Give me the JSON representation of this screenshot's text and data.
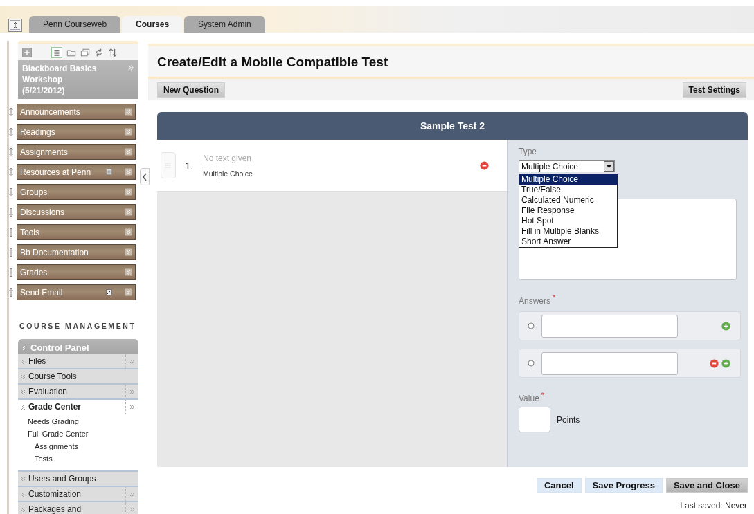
{
  "tabs": [
    {
      "label": "Penn Courseweb",
      "selected": false
    },
    {
      "label": "Courses",
      "selected": true
    },
    {
      "label": "System Admin",
      "selected": false
    }
  ],
  "course": {
    "title": "Blackboard Basics Workshop (5/21/2012)"
  },
  "course_menu": [
    {
      "label": "Announcements",
      "kind": "plain"
    },
    {
      "label": "Readings",
      "kind": "plain"
    },
    {
      "label": "Assignments",
      "kind": "plain"
    },
    {
      "label": "Resources at Penn",
      "kind": "link"
    },
    {
      "label": "Groups",
      "kind": "plain"
    },
    {
      "label": "Discussions",
      "kind": "plain"
    },
    {
      "label": "Tools",
      "kind": "plain"
    },
    {
      "label": "Bb Documentation",
      "kind": "plain"
    },
    {
      "label": "Grades",
      "kind": "plain"
    },
    {
      "label": "Send Email",
      "kind": "tool"
    }
  ],
  "management": {
    "heading": "COURSE MANAGEMENT",
    "panel_title": "Control Panel",
    "items": [
      {
        "label": "Files",
        "expanded": false,
        "submenu": true
      },
      {
        "label": "Course Tools",
        "expanded": false,
        "submenu": false
      },
      {
        "label": "Evaluation",
        "expanded": false,
        "submenu": true
      },
      {
        "label": "Grade Center",
        "expanded": true,
        "submenu": true,
        "children": [
          {
            "label": "Needs Grading"
          },
          {
            "label": "Full Grade Center",
            "children": [
              {
                "label": "Assignments"
              },
              {
                "label": "Tests"
              }
            ]
          }
        ]
      },
      {
        "label": "Users and Groups",
        "expanded": false,
        "submenu": false
      },
      {
        "label": "Customization",
        "expanded": false,
        "submenu": true
      },
      {
        "label": "Packages and",
        "expanded": false,
        "submenu": true
      }
    ]
  },
  "page": {
    "title": "Create/Edit a Mobile Compatible Test",
    "new_question": "New Question",
    "test_settings": "Test Settings"
  },
  "test": {
    "title": "Sample Test 2",
    "questions": [
      {
        "number": "1.",
        "text": "No text given",
        "type": "Multiple Choice"
      }
    ],
    "type_label": "Type",
    "type_value": "Multiple Choice",
    "type_options": [
      {
        "label": "Multiple Choice",
        "selected": true
      },
      {
        "label": "True/False",
        "selected": false
      },
      {
        "label": "Calculated Numeric",
        "selected": false
      },
      {
        "label": "File Response",
        "selected": false
      },
      {
        "label": "Hot Spot",
        "selected": false
      },
      {
        "label": "Fill in Multiple Blanks",
        "selected": false
      },
      {
        "label": "Short Answer",
        "selected": false
      }
    ],
    "answers_label": "Answers",
    "answers_mark": "*",
    "answers": [
      {
        "removable": false,
        "selected": false
      },
      {
        "removable": true,
        "selected": false
      }
    ],
    "value_label": "Value",
    "value_mark": "*",
    "points_label": "Points"
  },
  "buttons": [
    {
      "label": "Cancel",
      "kind": "secondary"
    },
    {
      "label": "Save Progress",
      "kind": "secondary"
    },
    {
      "label": "Save and Close",
      "kind": "primary"
    }
  ],
  "last_saved": "Last saved: Never"
}
